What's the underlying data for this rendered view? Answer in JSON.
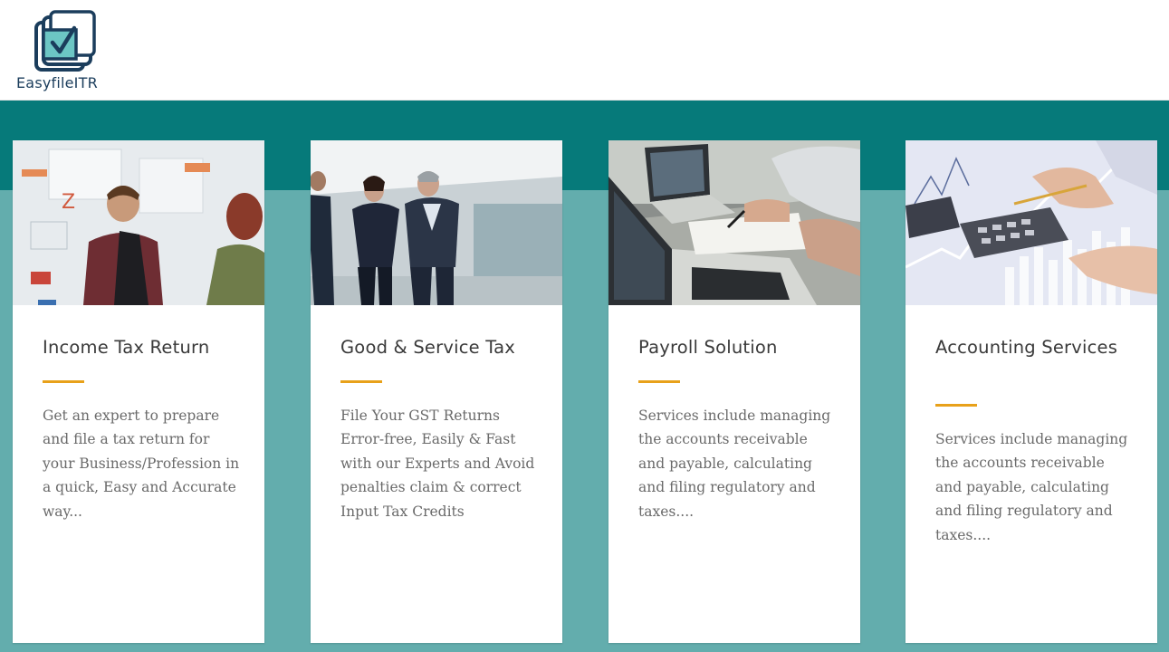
{
  "brand": {
    "name": "EasyfileITR",
    "colors": {
      "primary_dark": "#067a7a",
      "primary_light": "#63adad",
      "accent": "#e8a11a",
      "logo": "#1b3d5c"
    }
  },
  "cards": [
    {
      "title": "Income Tax Return",
      "description": "Get an expert to prepare and file a tax return for your Business/Profession in a quick, Easy and Accurate way...",
      "image": "office-whiteboard-people-photo"
    },
    {
      "title": "Good & Service Tax",
      "description": "File Your GST Returns Error-free, Easily & Fast with our Experts and Avoid penalties claim & correct Input Tax Credits",
      "image": "business-people-walking-photo"
    },
    {
      "title": "Payroll Solution",
      "description": "Services include managing the accounts receivable and payable, calculating and filing regulatory and taxes....",
      "image": "laptops-desk-paperwork-photo"
    },
    {
      "title": "Accounting Services",
      "description": "Services include managing the accounts receivable and payable, calculating and filing regulatory and taxes....",
      "image": "calculator-charts-photo"
    }
  ]
}
